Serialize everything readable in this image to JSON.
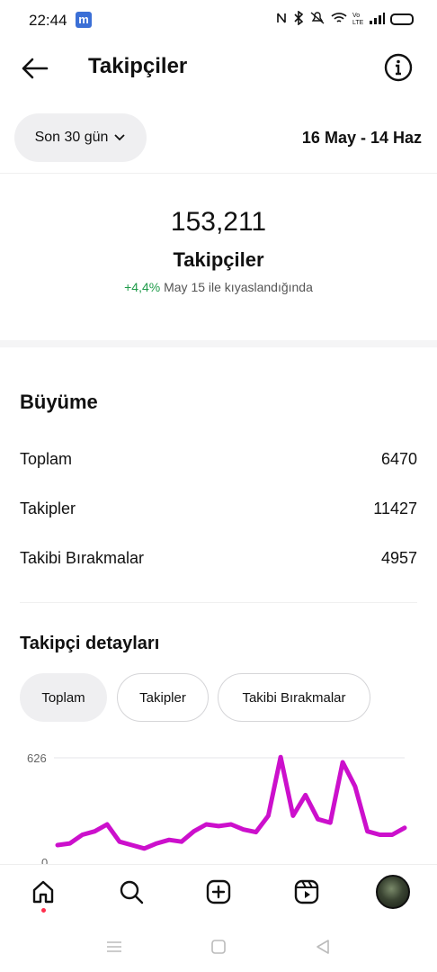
{
  "status_bar": {
    "time": "22:44",
    "app_badge": "m",
    "icons": [
      "nfc-icon",
      "bluetooth-icon",
      "mute-icon",
      "wifi-icon",
      "volte-icon",
      "signal-icon",
      "battery-icon"
    ]
  },
  "header": {
    "title": "Takipçiler"
  },
  "filters": {
    "range_label": "Son 30 gün",
    "date_range": "16 May - 14 Haz"
  },
  "summary": {
    "count": "153,211",
    "label": "Takipçiler",
    "change": "+4,4%",
    "compare_text": "May 15 ile kıyaslandığında"
  },
  "growth": {
    "title": "Büyüme",
    "rows": [
      {
        "label": "Toplam",
        "value": "6470"
      },
      {
        "label": "Takipler",
        "value": "11427"
      },
      {
        "label": "Takibi Bırakmalar",
        "value": "4957"
      }
    ]
  },
  "details": {
    "title": "Takipçi detayları",
    "tabs": [
      "Toplam",
      "Takipler",
      "Takibi Bırakmalar"
    ],
    "active_tab": "Toplam"
  },
  "chart_data": {
    "type": "line",
    "y_tick_labels": [
      "626",
      "0"
    ],
    "ylim": [
      0,
      626
    ],
    "series": [
      {
        "color": "#cc10cc",
        "values": [
          120,
          130,
          180,
          200,
          240,
          140,
          120,
          100,
          130,
          150,
          140,
          200,
          240,
          230,
          240,
          210,
          195,
          290,
          630,
          290,
          410,
          270,
          250,
          600,
          460,
          200,
          180,
          180,
          220
        ]
      }
    ]
  },
  "bottom_nav": {
    "items": [
      "home-icon",
      "search-icon",
      "create-icon",
      "reels-icon",
      "profile-avatar"
    ],
    "active": "home-icon"
  },
  "colors": {
    "accent_line": "#cc10cc",
    "positive": "#1f9b4a",
    "pill_bg": "#efeff1",
    "notification_dot": "#ff2e4c"
  }
}
